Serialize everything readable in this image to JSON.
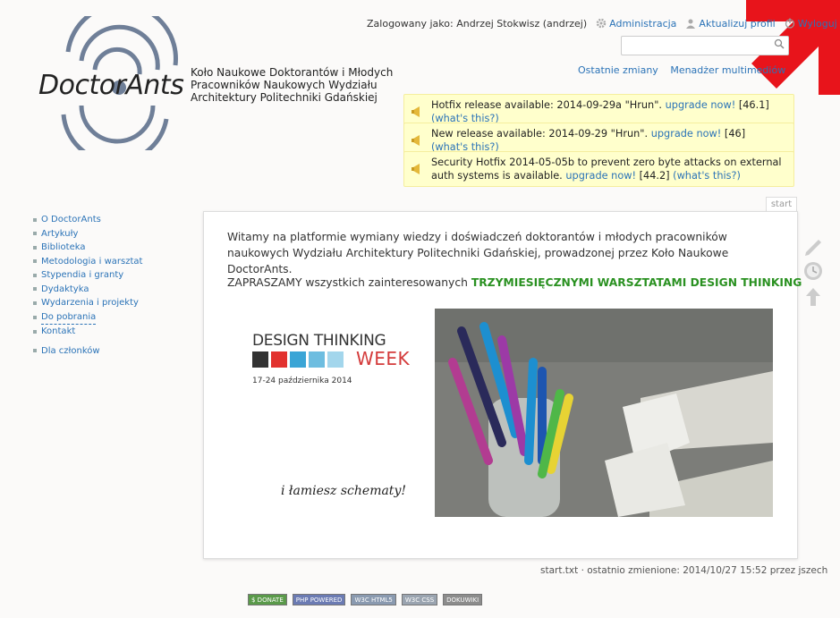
{
  "userbar": {
    "logged_in_as": "Zalogowany jako: Andrzej Stokwisz (andrzej)",
    "admin": "Administracja",
    "profile": "Aktualizuj profil",
    "logout": "Wyloguj"
  },
  "search": {
    "placeholder": ""
  },
  "sitetools": {
    "recent": "Ostatnie zmiany",
    "media": "Menadżer multimediów"
  },
  "logo": {
    "text": "DoctorAnts"
  },
  "org_name": "Koło Naukowe Doktorantów i Młodych Pracowników Naukowych Wydziału Architektury Politechniki Gdańskiej",
  "notices": [
    {
      "text": "Hotfix release available: 2014-09-29a \"Hrun\".",
      "link": "upgrade now!",
      "ver": "[46.1]",
      "what": "(what's this?)"
    },
    {
      "text": "New release available: 2014-09-29 \"Hrun\".",
      "link": "upgrade now!",
      "ver": "[46]",
      "what": "(what's this?)"
    },
    {
      "text": "Security Hotfix 2014-05-05b to prevent zero byte attacks on external auth systems is available.",
      "link": "upgrade now!",
      "ver": "[44.2]",
      "what": "(what's this?)"
    }
  ],
  "sidebar": {
    "items": [
      "O DoctorAnts",
      "Artykuły",
      "Biblioteka",
      "Metodologia i warsztat",
      "Stypendia i granty",
      "Dydaktyka",
      "Wydarzenia i projekty",
      "Do pobrania",
      "Kontakt"
    ],
    "members": "Dla członków"
  },
  "page": {
    "tab": "start",
    "intro": "Witamy na platformie wymiany wiedzy i doświadczeń doktorantów i młodych pracowników naukowych Wydziału Architektury Politechniki Gdańskiej, prowadzonej przez Koło Naukowe DoctorAnts.",
    "invite_prefix": "ZAPRASZAMY wszystkich zainteresowanych",
    "invite_strong": "TRZYMIESIĘCZNYMI WARSZTATAMI DESIGN THINKING",
    "dtw_title": "DESIGN THINKING",
    "dtw_week": "WEEK",
    "dtw_date": "17-24 października 2014",
    "dtw_tag": "i łamiesz schematy!",
    "meta": "start.txt · ostatnio zmienione: 2014/10/27 15:52 przez jszech"
  },
  "badges": [
    "$ DONATE",
    "PHP POWERED",
    "W3C HTML5",
    "W3C CSS",
    "DOKUWIKI"
  ],
  "colors": {
    "link": "#2b73b7",
    "notice_bg": "#ffffcc",
    "strong_green": "#2a9121",
    "arrow_red": "#e8141b"
  }
}
